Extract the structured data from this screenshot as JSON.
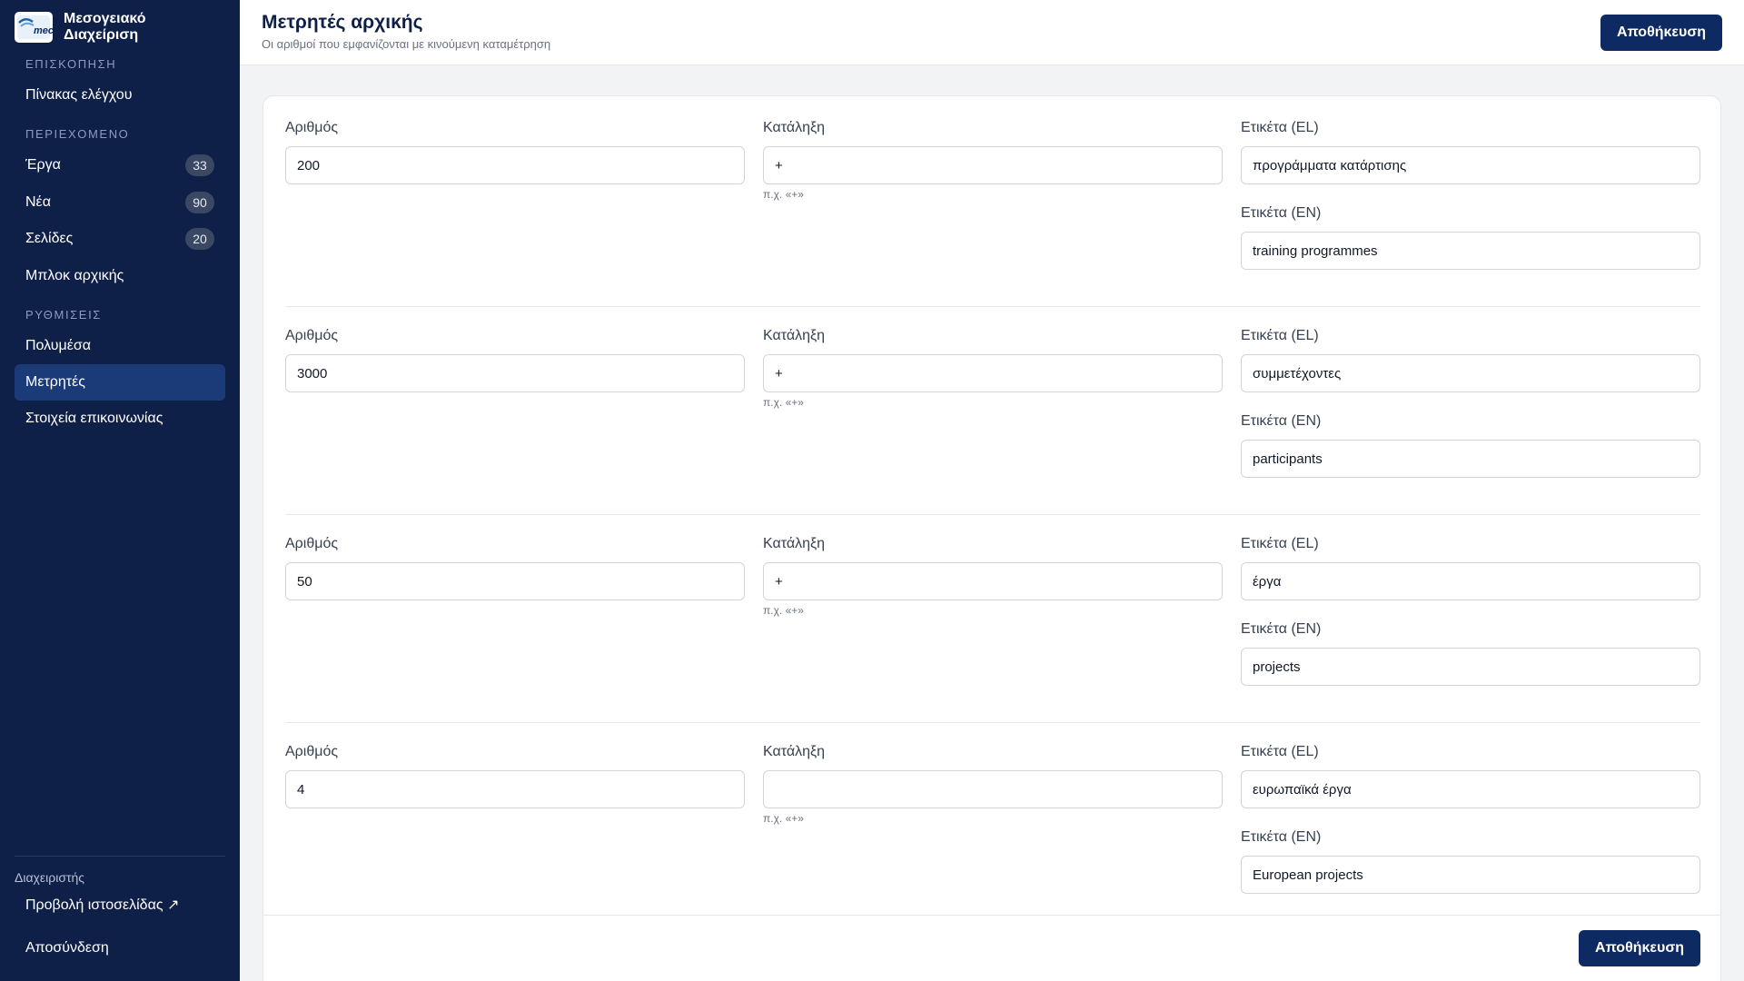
{
  "brand": {
    "name_line1": "Μεσογειακό",
    "name_line2": "Διαχείριση",
    "logo_text": "mec"
  },
  "sidebar": {
    "sections": [
      {
        "label": "ΕΠΙΣΚΟΠΗΣΗ"
      },
      {
        "label": "ΠΕΡΙΕΧΟΜΕΝΟ"
      },
      {
        "label": "ΡΥΘΜΙΣΕΙΣ"
      }
    ],
    "items": [
      {
        "label": "Πίνακας ελέγχου"
      },
      {
        "label": "Έργα",
        "count": "33"
      },
      {
        "label": "Νέα",
        "count": "90"
      },
      {
        "label": "Σελίδες",
        "count": "20"
      },
      {
        "label": "Μπλοκ αρχικής"
      },
      {
        "label": "Πολυμέσα"
      },
      {
        "label": "Μετρητές"
      },
      {
        "label": "Στοιχεία επικοινωνίας"
      }
    ],
    "footer_label": "Διαχειριστής",
    "view_site": "Προβολή ιστοσελίδας ↗",
    "logout": "Αποσύνδεση"
  },
  "header": {
    "title": "Μετρητές αρχικής",
    "subtitle": "Οι αριθμοί που εμφανίζονται με κινούμενη καταμέτρηση",
    "save_label": "Αποθήκευση"
  },
  "labels": {
    "number": "Αριθμός",
    "suffix": "Κατάληξη",
    "label_el": "Ετικέτα (EL)",
    "label_en": "Ετικέτα (EN)",
    "suffix_hint": "π.χ. «+»"
  },
  "counters": [
    {
      "number": "200",
      "suffix": "+",
      "label_el": "προγράμματα κατάρτισης",
      "label_en": "training programmes"
    },
    {
      "number": "3000",
      "suffix": "+",
      "label_el": "συμμετέχοντες",
      "label_en": "participants"
    },
    {
      "number": "50",
      "suffix": "+",
      "label_el": "έργα",
      "label_en": "projects"
    },
    {
      "number": "4",
      "suffix": "",
      "label_el": "ευρωπαϊκά έργα",
      "label_en": "European projects"
    }
  ],
  "footer": {
    "save_label": "Αποθήκευση"
  },
  "colors": {
    "sidebar_bg": "#0e1f48",
    "active_item": "#1a3a78",
    "primary_button": "#0e2a63"
  }
}
